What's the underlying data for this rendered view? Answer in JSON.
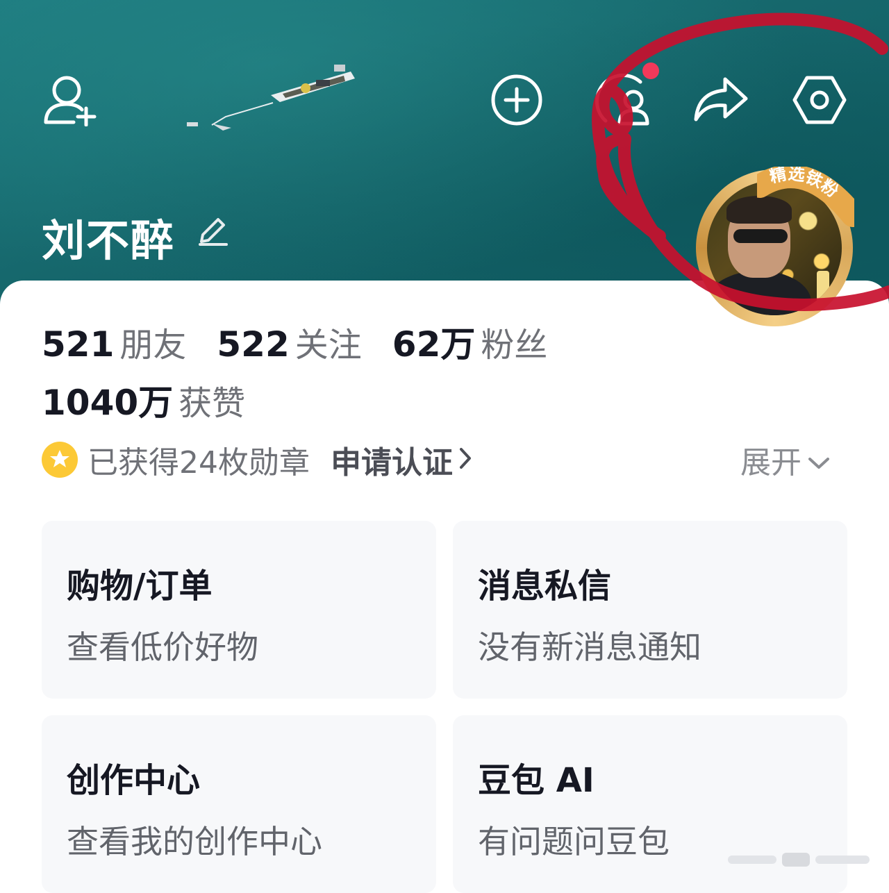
{
  "profile": {
    "username": "刘不醉",
    "stats": [
      {
        "value": "521",
        "label": "朋友"
      },
      {
        "value": "522",
        "label": "关注"
      },
      {
        "value": "62万",
        "label": "粉丝"
      }
    ],
    "likes": {
      "value": "1040万",
      "label": "获赞"
    },
    "medals_text": "已获得24枚勋章",
    "verify_label": "申请认证",
    "expand_label": "展开",
    "avatar_badge": "精选铁粉"
  },
  "header_icons": [
    "add-friend-icon",
    "create-plus-icon",
    "visitors-icon",
    "share-icon",
    "settings-icon"
  ],
  "tiles": [
    {
      "title": "购物/订单",
      "subtitle": "查看低价好物"
    },
    {
      "title": "消息私信",
      "subtitle": "没有新消息通知"
    },
    {
      "title": "创作中心",
      "subtitle": "查看我的创作中心"
    },
    {
      "title": "豆包 AI",
      "subtitle": "有问题问豆包"
    }
  ],
  "colors": {
    "header_sea": "#16676c",
    "notification_dot": "#f2395a",
    "annotation_red": "#c8102e",
    "medal_gold": "#fcc936",
    "tile_bg": "#f7f8fa"
  }
}
